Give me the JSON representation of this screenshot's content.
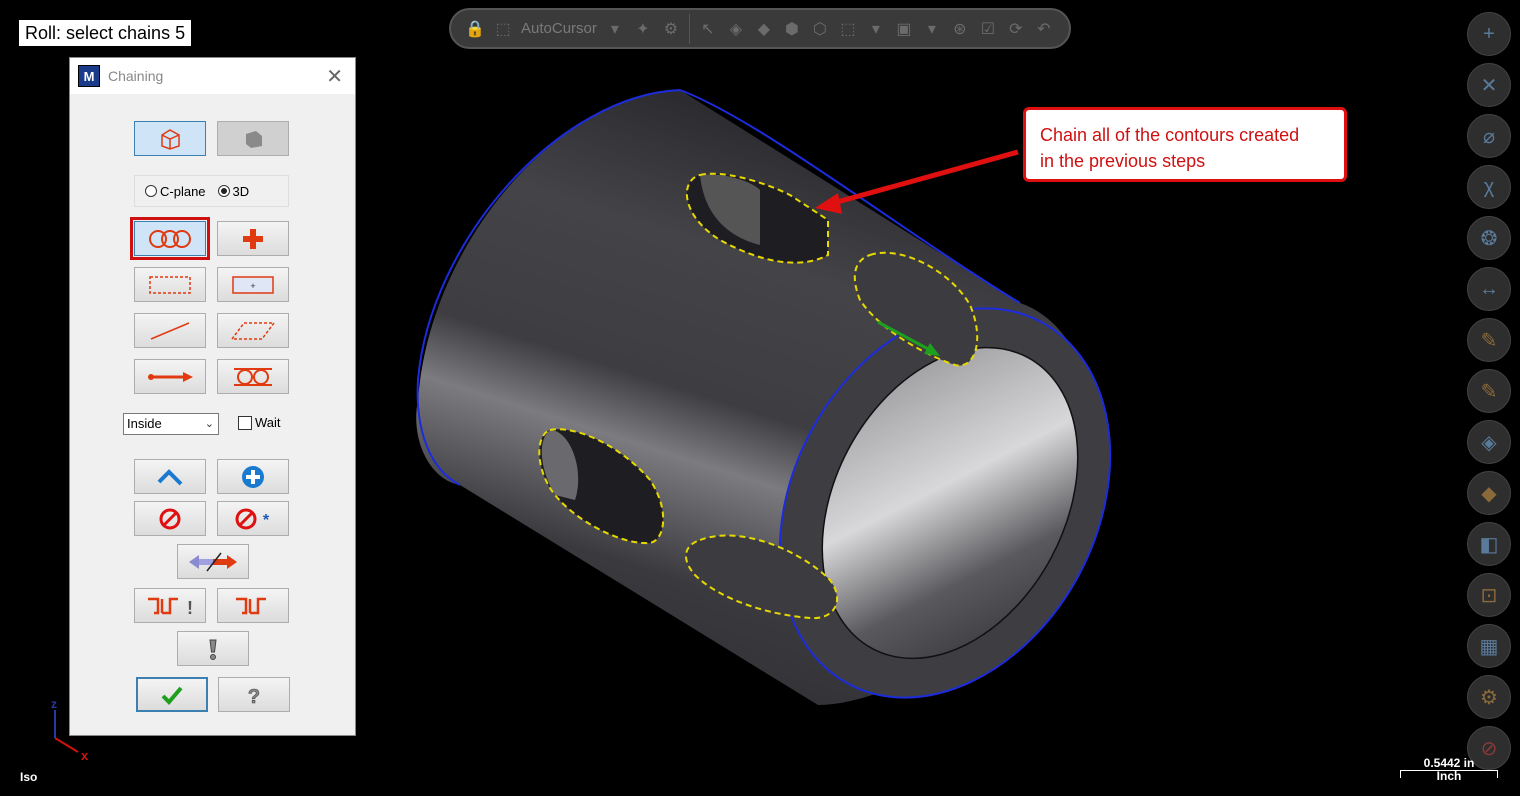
{
  "status": {
    "prompt": "Roll: select chains 5"
  },
  "toolbar": {
    "autocursor_label": "AutoCursor"
  },
  "dialog": {
    "title": "Chaining",
    "close_glyph": "✕",
    "plane_option": "C-plane",
    "mode_option": "3D",
    "selected_mode": "3D",
    "dropdown_value": "Inside",
    "wait_label": "Wait",
    "wait_checked": false
  },
  "callout": {
    "line1": "Chain all of the contours created",
    "line2": "in the previous steps"
  },
  "view": {
    "name": "Iso"
  },
  "scale": {
    "value": "0.5442 in",
    "unit": "Inch"
  },
  "axis": {
    "z": "z",
    "x": "x"
  },
  "colors": {
    "accent_red": "#e01010",
    "selection_yellow": "#e6d800",
    "edge_blue": "#1c2cdc",
    "arrow_green": "#1ea01e"
  }
}
